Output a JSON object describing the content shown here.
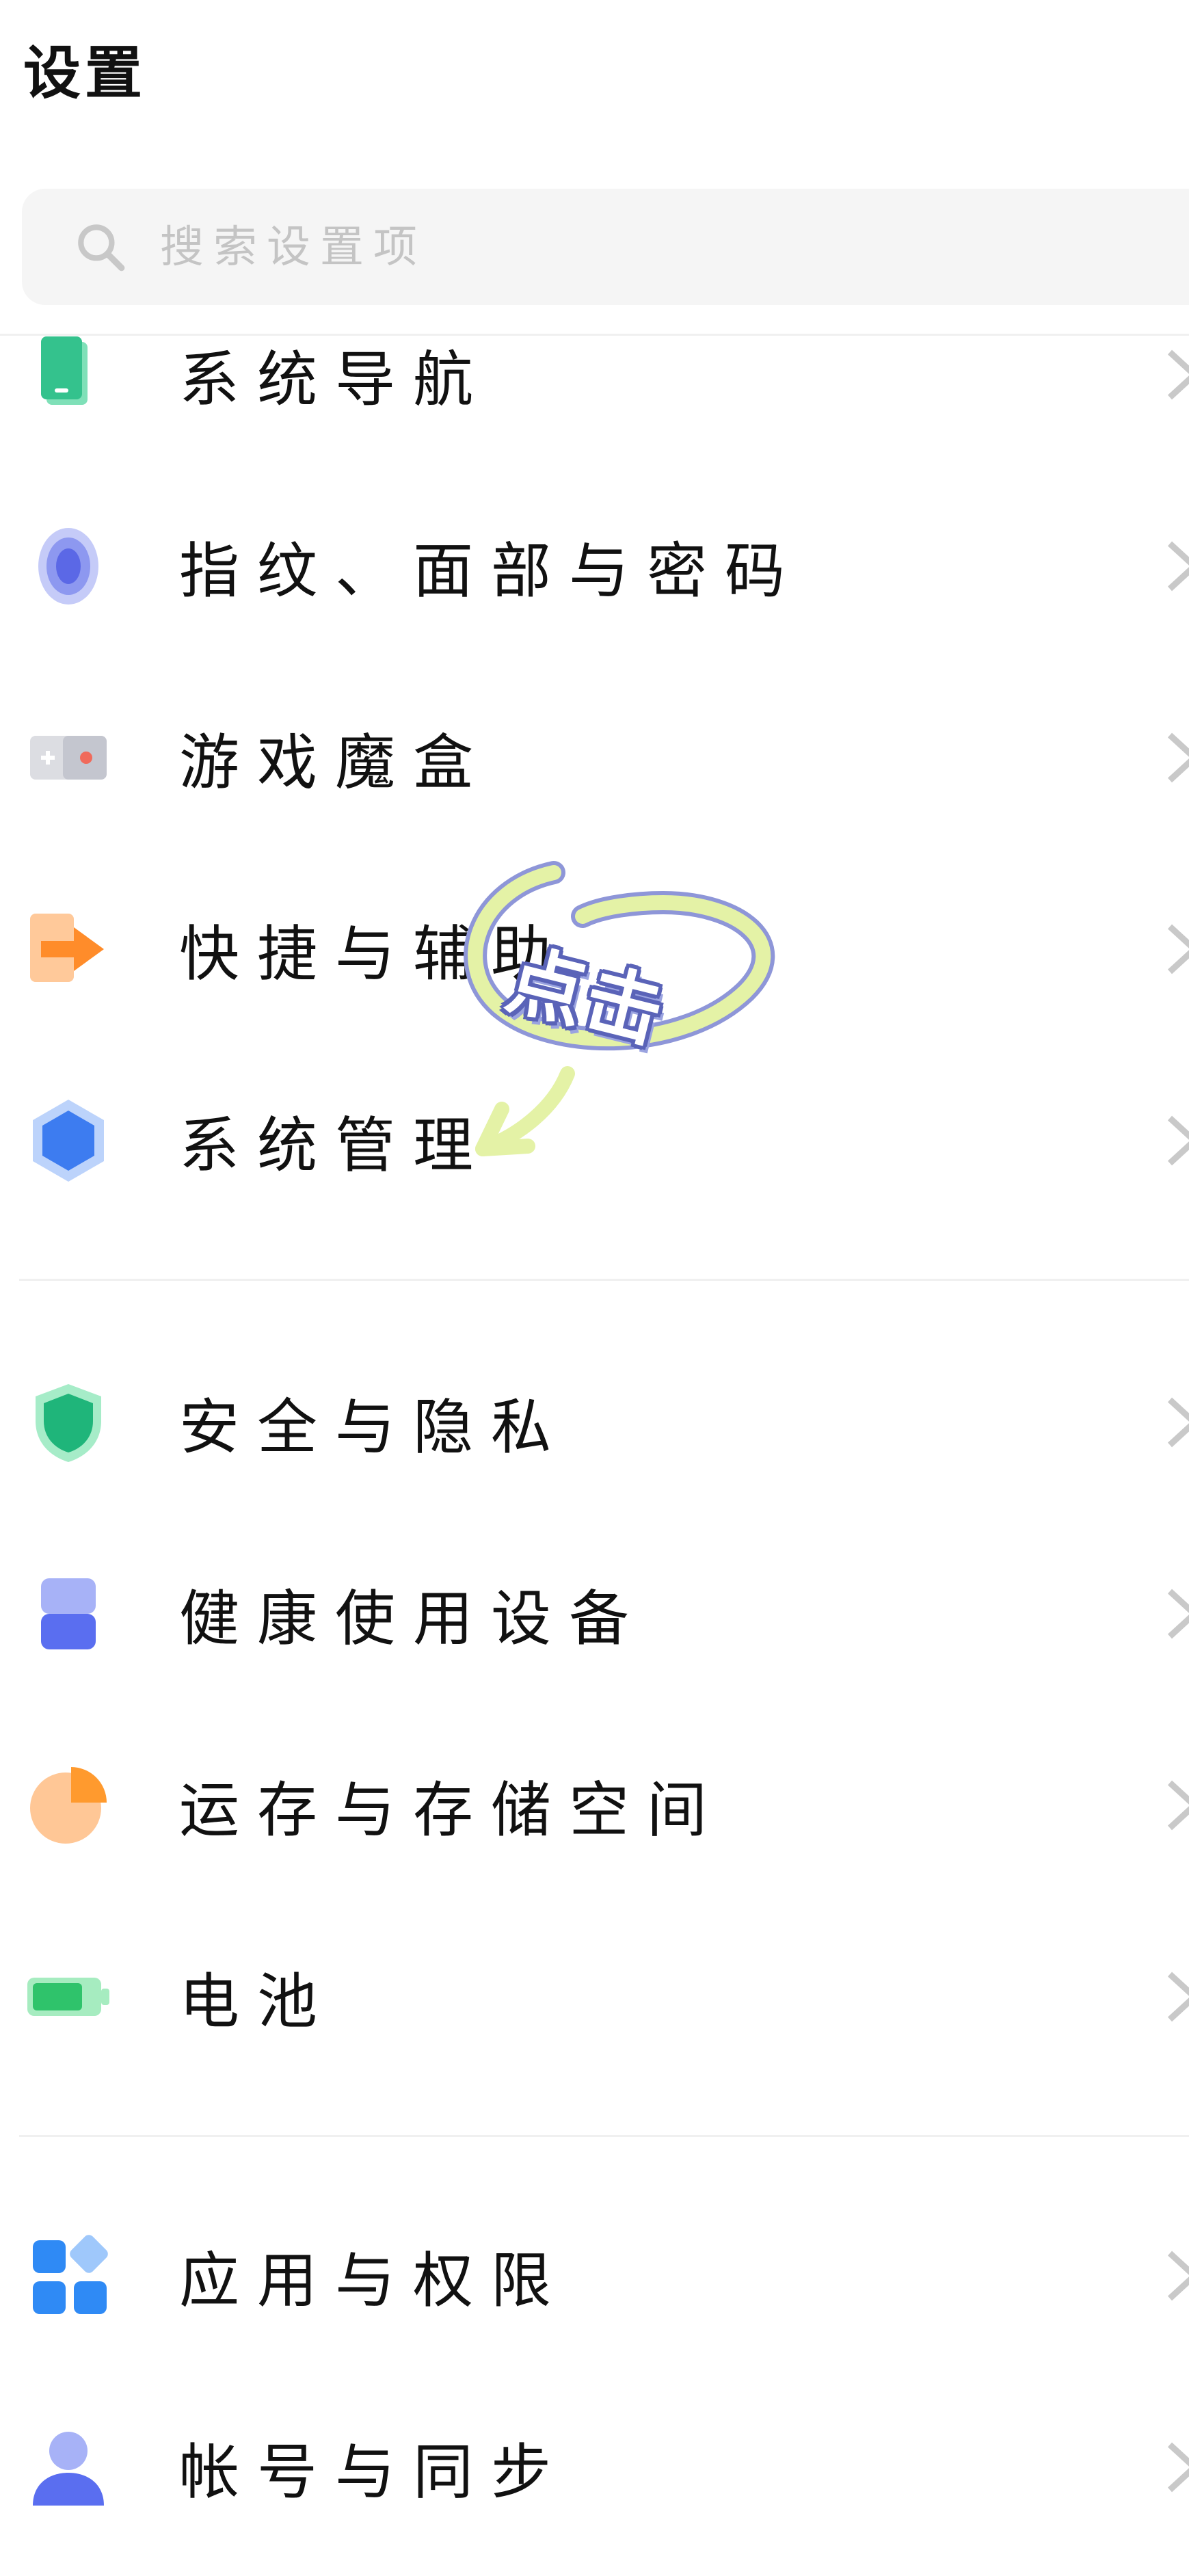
{
  "header": {
    "title": "设置"
  },
  "search": {
    "placeholder": "搜索设置项",
    "value": ""
  },
  "items": [
    {
      "label": "系统导航",
      "icon": "phone-navigation-icon"
    },
    {
      "label": "指纹、面部与密码",
      "icon": "fingerprint-icon"
    },
    {
      "label": "游戏魔盒",
      "icon": "game-box-icon"
    },
    {
      "label": "快捷与辅助",
      "icon": "shortcut-arrow-icon"
    },
    {
      "label": "系统管理",
      "icon": "hexagon-icon"
    },
    {
      "label": "安全与隐私",
      "icon": "shield-icon"
    },
    {
      "label": "健康使用设备",
      "icon": "hourglass-icon"
    },
    {
      "label": "运存与存储空间",
      "icon": "storage-pie-icon"
    },
    {
      "label": "电池",
      "icon": "battery-icon"
    },
    {
      "label": "应用与权限",
      "icon": "apps-grid-icon"
    },
    {
      "label": "帐号与同步",
      "icon": "account-icon"
    }
  ],
  "overlay": {
    "text": "点击"
  },
  "colors": {
    "accent_blue": "#3d7cf0",
    "overlay_ring": "#e4f2a6",
    "overlay_text_outline": "#5a63b8"
  }
}
